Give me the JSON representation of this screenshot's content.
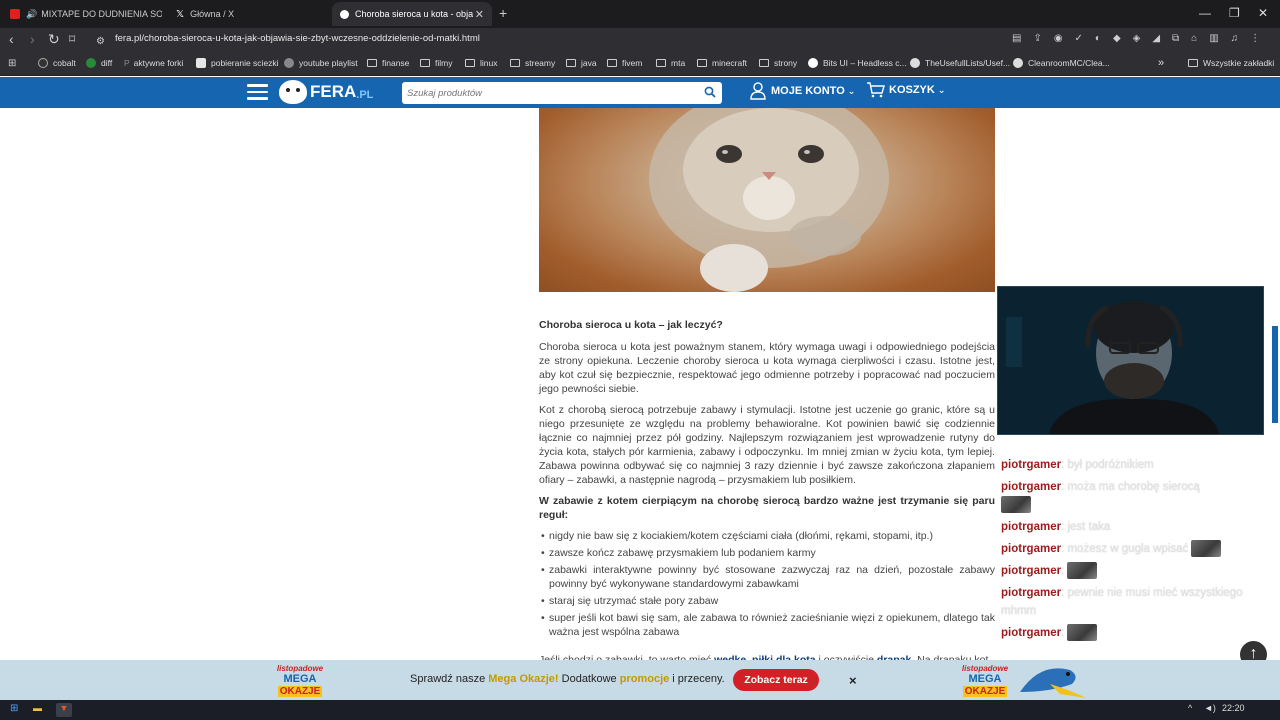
{
  "tabs": [
    {
      "label": "MIXTAPE DO DUDNIENIA SOLAR",
      "favicon": "youtube-icon",
      "audio": true
    },
    {
      "label": "Główna / X",
      "favicon": "x-icon"
    },
    {
      "label": "Choroba sieroca u kota - objaw",
      "favicon": "fera-icon",
      "active": true
    }
  ],
  "new_tab": "+",
  "address_bar": {
    "url": "fera.pl/choroba-sieroca-u-kota-jak-objawia-sie-zbyt-wczesne-oddzielenie-od-matki.html"
  },
  "bookmarks": [
    "cobalt",
    "diff",
    "aktywne forki",
    "pobieranie sciezki",
    "youtube playlist",
    "finanse",
    "filmy",
    "linux",
    "streamy",
    "java",
    "fivem",
    "mta",
    "minecraft",
    "strony",
    "Bits UI – Headless c...",
    "TheUsefullLists/Usef...",
    "CleanroomMC/Clea..."
  ],
  "bookmarks_more": "»",
  "all_bookmarks": "Wszystkie zakładki",
  "site": {
    "logo_main": "FERA",
    "logo_tld": ".PL",
    "search_placeholder": "Szukaj produktów",
    "account_label": "MOJE KONTO",
    "cart_label": "KOSZYK"
  },
  "article": {
    "heading": "Choroba sieroca u kota – jak leczyć?",
    "p1": "Choroba sieroca u kota jest poważnym stanem, który wymaga uwagi i odpowiedniego podejścia ze strony opiekuna. Leczenie choroby sieroca u kota wymaga cierpliwości i czasu. Istotne jest, aby kot czuł się bezpiecznie, respektować jego odmienne potrzeby i popracować nad poczuciem jego pewności siebie.",
    "p2": "Kot z chorobą sierocą potrzebuje zabawy i stymulacji. Istotne jest uczenie go granic, które są u niego przesunięte ze względu na problemy behawioralne. Kot powinien bawić się codziennie łącznie co najmniej przez pół godziny. Najlepszym rozwiązaniem jest wprowadzenie rutyny do życia kota, stałych pór karmienia, zabawy i odpoczynku. Im mniej zmian w życiu kota, tym lepiej. Zabawa powinna odbywać się co najmniej 3 razy dziennie i być zawsze zakończona złapaniem ofiary – zabawki, a następnie nagrodą – przysmakiem lub posiłkiem.",
    "p3": "W zabawie z kotem cierpiącym na chorobę sierocą bardzo ważne jest trzymanie się paru reguł:",
    "rules": [
      "nigdy nie baw się z kociakiem/kotem częściami ciała (dłońmi, rękami, stopami, itp.)",
      "zawsze kończ zabawę przysmakiem lub podaniem karmy",
      "zabawki interaktywne powinny być stosowane zazwyczaj raz na dzień, pozostałe zabawy powinny być wykonywane standardowymi zabawkami",
      "staraj się utrzymać stałe pory zabaw",
      "super jeśli kot bawi się sam, ale zabawa to również zacieśnianie więzi z opiekunem, dlatego tak ważna jest wspólna zabawa"
    ],
    "p4_start": "Jeśli chodzi o zabawki, to warto mieć ",
    "link1": "wędkę",
    "p4_sep": ", ",
    "link2": "piłki dla kota",
    "p4_mid": " i oczywiście ",
    "link3": "drapak",
    "p4_end": ". Na drapaku kot"
  },
  "chat": [
    {
      "user": "piotrgamer",
      "text": "był podróżnikiem"
    },
    {
      "user": "piotrgamer",
      "text": "moża ma chorobę sierocą",
      "emote": true
    },
    {
      "user": "piotrgamer",
      "text": "jest taka"
    },
    {
      "user": "piotrgamer",
      "text": "możesz w gugla wpisać",
      "emote_inline": true
    },
    {
      "user": "piotrgamer",
      "text": "",
      "emote_inline": true
    },
    {
      "user": "piotrgamer",
      "text": "pewnie nie musi mieć wszystkiego mhmm"
    },
    {
      "user": "piotrgamer",
      "text": "",
      "emote_inline": true
    }
  ],
  "promo": {
    "badge_line1": "listopadowe",
    "badge_line2": "MEGA",
    "badge_line3": "OKAZJE",
    "text_start": "Sprawdź nasze ",
    "text_mega": "Mega Okazje!",
    "text_mid": " Dodatkowe ",
    "text_promo": "promocje",
    "text_end": " i przeceny.",
    "button": "Zobacz teraz",
    "close": "×"
  },
  "taskbar": {
    "time": "22:20"
  },
  "colors": {
    "header_blue": "#1565b0",
    "promo_red": "#d32027",
    "chat_user": "#9b1b1b"
  }
}
